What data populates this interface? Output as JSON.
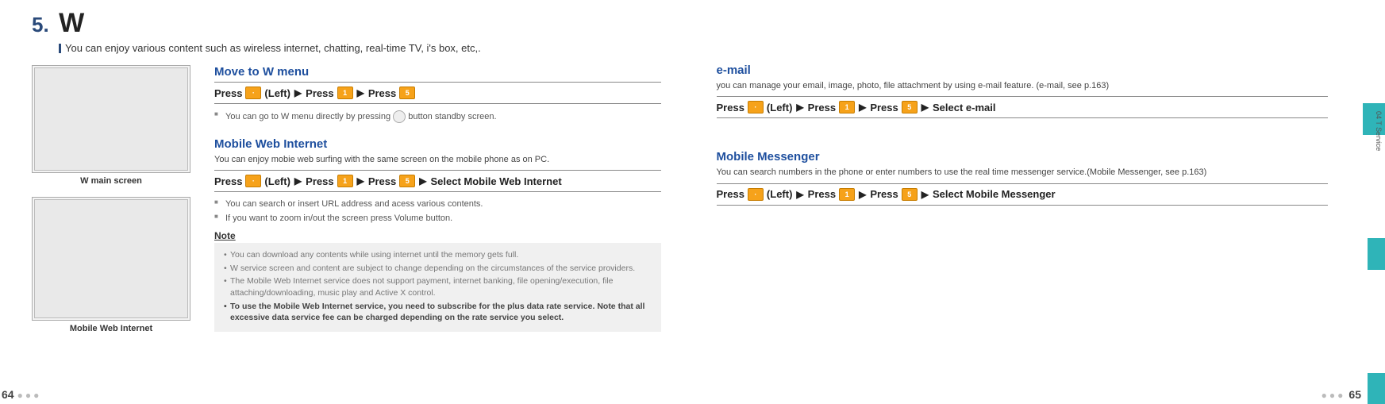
{
  "chapter": {
    "num": "5.",
    "title": "W",
    "sub": "You can enjoy various content such as wireless internet, chatting, real-time TV, i's box, etc,."
  },
  "screens": {
    "label1": "W main screen",
    "label2": "Mobile Web Internet"
  },
  "move": {
    "title": "Move to W menu",
    "press": "Press",
    "left": "(Left)",
    "k1": "·",
    "k2": "1",
    "k3": "5",
    "bullet1_a": "You can go to W menu directly by pressing",
    "bullet1_b": "button standby screen."
  },
  "mwi": {
    "title": "Mobile Web Internet",
    "sub": "You can enjoy mobie web surfing with the same screen on the mobile phone as on PC.",
    "press": "Press",
    "left": "(Left)",
    "select": "Select Mobile Web Internet",
    "k1": "·",
    "k2": "1",
    "k3": "5",
    "bullet1": "You can search or insert URL address and acess various contents.",
    "bullet2": "If you want to zoom in/out the screen press Volume button.",
    "note_head": "Note",
    "n1": "You can download any contents while using internet until the memory gets full.",
    "n2": "W service screen and content are subject to change depending on the circumstances of the service providers.",
    "n3": "The Mobile Web Internet service does not support payment, internet banking, file opening/execution, file attaching/downloading, music play and Active X control.",
    "n4": "To use the Mobile Web Internet service, you need to subscribe for the plus data rate service. Note that all excessive data service fee can be charged depending on the rate service you select."
  },
  "email": {
    "title": "e-mail",
    "sub": "you can manage your email, image, photo, file attachment by using e-mail feature. (e-mail, see p.163)",
    "press": "Press",
    "left": "(Left)",
    "select": "Select e-mail",
    "k1": "·",
    "k2": "1",
    "k3": "5"
  },
  "mm": {
    "title": "Mobile Messenger",
    "sub": "You can search numbers in the phone or enter numbers to use the real time messenger service.(Mobile Messenger, see p.163)",
    "press": "Press",
    "left": "(Left)",
    "select": "Select Mobile Messenger",
    "k1": "·",
    "k2": "1",
    "k3": "5"
  },
  "sidetab": "04  T Service",
  "page_left": "64",
  "page_right": "65",
  "arrow": "▶"
}
